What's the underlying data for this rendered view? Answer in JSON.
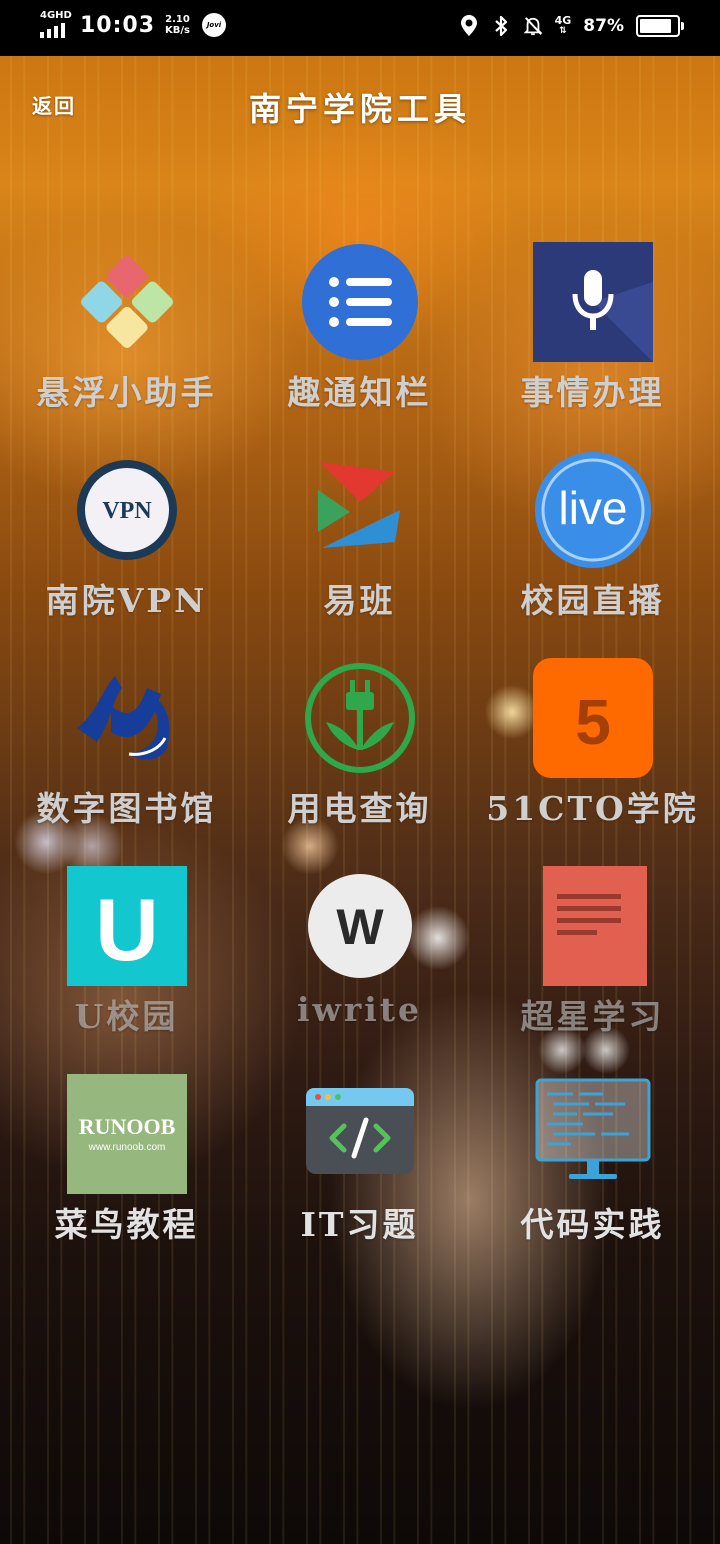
{
  "status_bar": {
    "network_type": "4GHD",
    "time": "10:03",
    "speed_value": "2.10",
    "speed_unit": "KB/s",
    "jovi": "Jovi",
    "mobile_net": "4G",
    "battery_percent": "87%",
    "battery_level": 0.87
  },
  "header": {
    "back_label": "返回",
    "title": "南宁学院工具"
  },
  "apps": [
    {
      "label": "悬浮小助手",
      "icon": "floating-assistant-icon"
    },
    {
      "label": "趣通知栏",
      "icon": "notification-list-icon"
    },
    {
      "label": "事情办理",
      "icon": "microphone-icon"
    },
    {
      "label": "南院VPN",
      "icon": "vpn-icon",
      "icon_text": "VPN"
    },
    {
      "label": "易班",
      "icon": "yiban-icon"
    },
    {
      "label": "校园直播",
      "icon": "live-icon",
      "icon_text": "live"
    },
    {
      "label": "数字图书馆",
      "icon": "digital-library-icon"
    },
    {
      "label": "用电查询",
      "icon": "electricity-plug-icon"
    },
    {
      "label": "51CTO学院",
      "icon": "51cto-icon",
      "icon_text": "5"
    },
    {
      "label": "U校园",
      "icon": "u-campus-icon",
      "icon_text": "U"
    },
    {
      "label": "iwrite",
      "icon": "iwrite-icon",
      "icon_text": "W"
    },
    {
      "label": "超星学习",
      "icon": "chaoxing-document-icon"
    },
    {
      "label": "菜鸟教程",
      "icon": "runoob-icon",
      "icon_text": "RUNOOB",
      "icon_subtext": "www.runoob.com"
    },
    {
      "label": "IT习题",
      "icon": "code-window-icon"
    },
    {
      "label": "代码实践",
      "icon": "code-monitor-icon"
    }
  ],
  "colors": {
    "label_gray": "#cfcfcf",
    "notification_blue": "#2f6fd6",
    "mic_navy": "#2d3a7a",
    "live_blue": "#3b8ee8",
    "cto_orange": "#ff6a00",
    "u_teal": "#13c7cf",
    "chaoxing_red": "#e2604f",
    "runoob_green": "#96b77d",
    "electric_green": "#2ea84a"
  }
}
